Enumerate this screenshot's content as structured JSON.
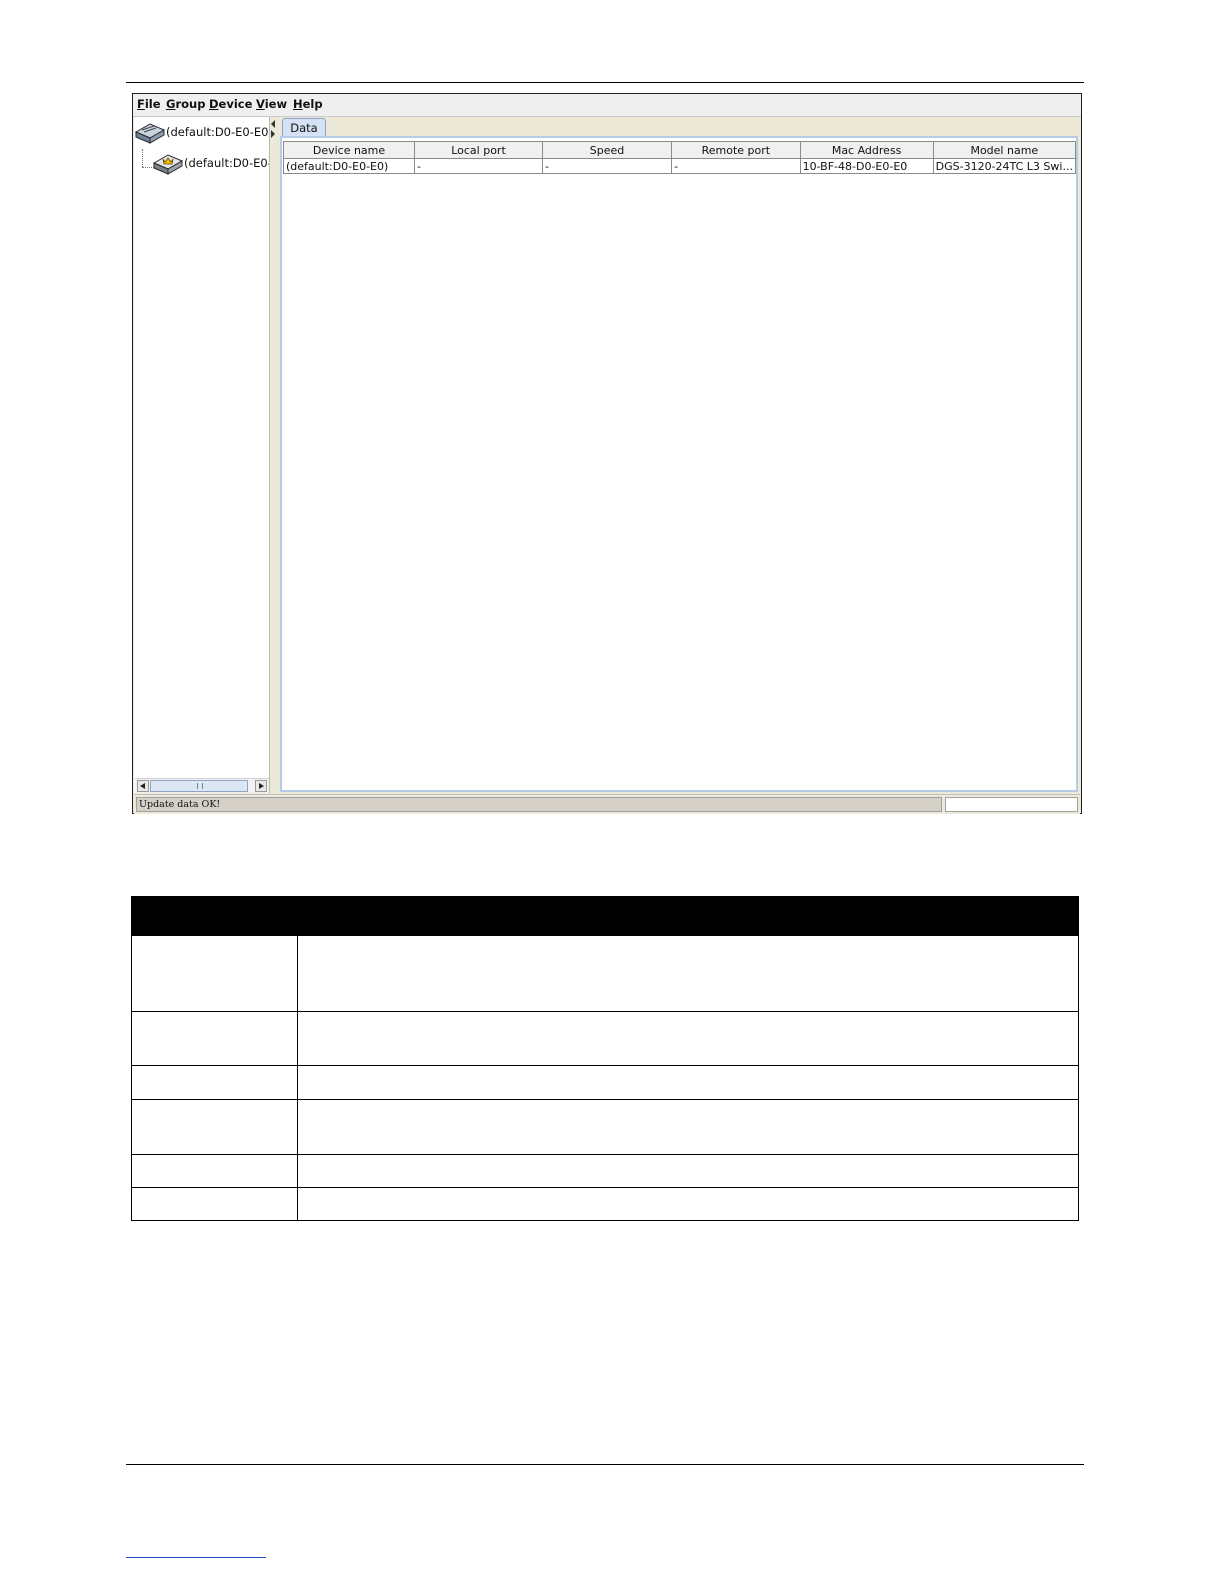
{
  "menubar": {
    "items": [
      "File",
      "Group",
      "Device",
      "View",
      "Help"
    ]
  },
  "tree": {
    "root_label": "(default:D0-E0-E0)",
    "child_label": "(default:D0-E0-E"
  },
  "tabs": [
    "Data"
  ],
  "data_table": {
    "columns": [
      "Device name",
      "Local port",
      "Speed",
      "Remote port",
      "Mac Address",
      "Model name"
    ],
    "rows": [
      [
        "(default:D0-E0-E0)",
        "-",
        "-",
        "-",
        "10-BF-48-D0-E0-E0",
        "DGS-3120-24TC L3 Swi..."
      ]
    ]
  },
  "status_bar": {
    "message": "Update data OK!"
  },
  "icons": {
    "root": "switch-device-icon",
    "child": "switch-device-master-icon"
  }
}
